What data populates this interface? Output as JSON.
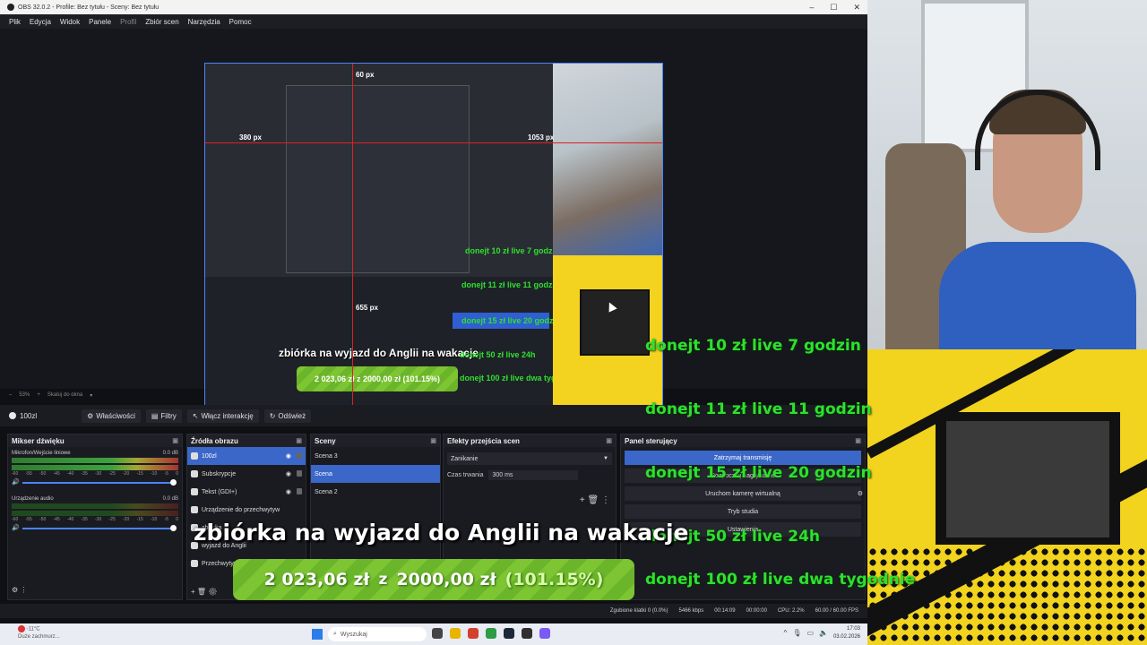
{
  "window": {
    "title": "OBS 32.0.2 - Profile: Bez tytułu - Sceny: Bez tytułu",
    "controls": [
      "–",
      "☐",
      "✕"
    ]
  },
  "menu": {
    "items": [
      "Plik",
      "Edycja",
      "Widok",
      "Panele",
      "Profil",
      "Zbiór scen",
      "Narzędzia",
      "Pomoc"
    ]
  },
  "preview": {
    "labels": {
      "top": "60 px",
      "left": "380 px",
      "right": "1053 px",
      "bottom": "655 px"
    },
    "zoom": "53%",
    "scale_mode": "Skaluj do okna"
  },
  "source_toolbar": {
    "source_name": "100zl",
    "properties": "Właściwości",
    "filters": "Filtry",
    "interact": "Włącz interakcję",
    "refresh": "Odśwież"
  },
  "mixer": {
    "title": "Mikser dźwięku",
    "tracks": [
      {
        "name": "Mikrofon/Wejście liniowe",
        "db": "0.0 dB",
        "level": 0.7
      },
      {
        "name": "Urządzenie audio",
        "db": "0.0 dB",
        "level": 0.0
      }
    ],
    "scale": [
      "-60",
      "-55",
      "-50",
      "-45",
      "-40",
      "-35",
      "-30",
      "-25",
      "-20",
      "-15",
      "-10",
      "-5",
      "0"
    ]
  },
  "sources": {
    "title": "Źródła obrazu",
    "items": [
      "100zl",
      "Subskrypcje",
      "Tekst (GDI+)",
      "Urządzenie do przechwytyw",
      "zbiórka",
      "wyjazd do Anglii",
      "Przechwytywanie"
    ]
  },
  "scenes": {
    "title": "Sceny",
    "items": [
      "Scena 3",
      "Scena",
      "Scena 2"
    ]
  },
  "transitions": {
    "title": "Efekty przejścia scen",
    "selected": "Zanikanie",
    "duration_label": "Czas trwania",
    "duration_value": "300 ms"
  },
  "controls": {
    "title": "Panel sterujący",
    "stop_stream": "Zatrzymaj transmisję",
    "start_recording": "Rozpocznij nagrywanie",
    "virtual_cam": "Uruchom kamerę wirtualną",
    "studio_mode": "Tryb studia",
    "settings": "Ustawienia"
  },
  "status": {
    "dropped": "Zgubione klatki 0 (0.0%)",
    "bitrate": "5466 kbps",
    "stream_time": "00:14:09",
    "rec_time": "00:00:00",
    "cpu": "CPU: 2.2%",
    "fps": "60.00 / 60.00 FPS"
  },
  "taskbar": {
    "weather_temp": "-11°C",
    "weather_desc": "Duże zachmurz...",
    "search_placeholder": "Wyszukaj",
    "time": "17:03",
    "date": "03.02.2026"
  },
  "overlay": {
    "goal_title": "zbiórka na wyjazd do Anglii na wakacje",
    "goal_current": "2 023,06 zł",
    "goal_separator": "z",
    "goal_target": "2000,00 zł",
    "goal_percent": "(101.15%)",
    "rewards": [
      "donejt 10 zł live 7 godzin",
      "donejt 11 zł live 11 godzin",
      "donejt 15 zł live 20 godzin",
      "donejt 50 zł live 24h",
      "donejt 100 zł live dwa tygodnie"
    ]
  },
  "mini_overlay": {
    "goal_title": "zbiórka na wyjazd do Anglii na wakacje",
    "goal_line": "2 023,06 zł z 2000,00 zł (101.15%)",
    "rewards": [
      "donejt 10 zł live 7 godzin",
      "donejt 11 zł live 11 godzin",
      "donejt 15 zł live 20 godzin",
      "donejt 50 zł live 24h",
      "donejt 100 zł live dwa tygodnie"
    ]
  },
  "colors": {
    "accent": "#3b67c9",
    "reward_green": "#2ee02e",
    "goal_green": "#7dc532",
    "overlay_yellow": "#f2d31e"
  }
}
